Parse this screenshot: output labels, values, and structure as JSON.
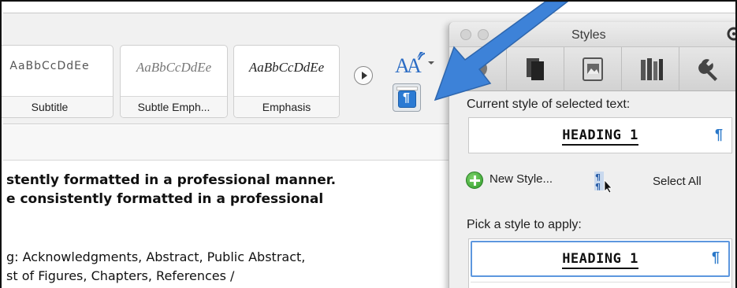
{
  "ribbon": {
    "style_gallery": [
      {
        "sample": "AaBbCcDdEe",
        "name": "Subtitle"
      },
      {
        "sample": "AaBbCcDdEe",
        "name": "Subtle Emph..."
      },
      {
        "sample": "AaBbCcDdEe",
        "name": "Emphasis"
      }
    ]
  },
  "document": {
    "lines": [
      "stently formatted in a professional manner.",
      "e consistently formatted in a professional",
      "g: Acknowledgments, Abstract, Public Abstract,",
      "st of Figures, Chapters, References /"
    ]
  },
  "palette": {
    "title": "Styles",
    "current_label": "Current style of selected text:",
    "current_style": "HEADING 1",
    "pilcrow": "¶",
    "new_style": "New Style...",
    "select_all": "Select All",
    "pick_label": "Pick a style to apply:",
    "apply_items": [
      "HEADING 1"
    ]
  },
  "colors": {
    "accent": "#2a78c9",
    "annotation_arrow": "#3d82d8",
    "add_green": "#2e9a2a"
  }
}
